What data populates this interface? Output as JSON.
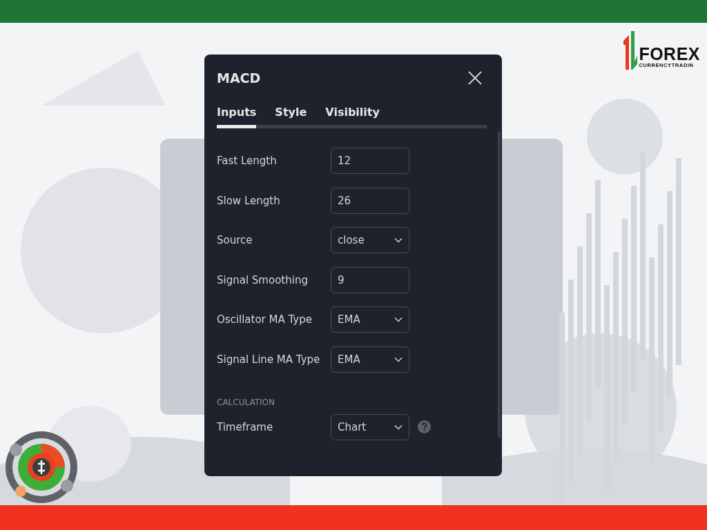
{
  "logo": {
    "word": "FOREX",
    "tagline": "CURRENCYTRADIN"
  },
  "dialog": {
    "title": "MACD",
    "tabs": [
      {
        "label": "Inputs",
        "selected": true
      },
      {
        "label": "Style",
        "selected": false
      },
      {
        "label": "Visibility",
        "selected": false
      }
    ],
    "inputs": [
      {
        "label": "Fast Length",
        "kind": "number",
        "value": "12"
      },
      {
        "label": "Slow Length",
        "kind": "number",
        "value": "26"
      },
      {
        "label": "Source",
        "kind": "select",
        "value": "close"
      },
      {
        "label": "Signal Smoothing",
        "kind": "number",
        "value": "9"
      },
      {
        "label": "Oscillator MA Type",
        "kind": "select",
        "value": "EMA"
      },
      {
        "label": "Signal Line MA Type",
        "kind": "select",
        "value": "EMA"
      }
    ],
    "section": "CALCULATION",
    "calculation": [
      {
        "label": "Timeframe",
        "kind": "select",
        "value": "Chart",
        "help": true
      }
    ]
  }
}
